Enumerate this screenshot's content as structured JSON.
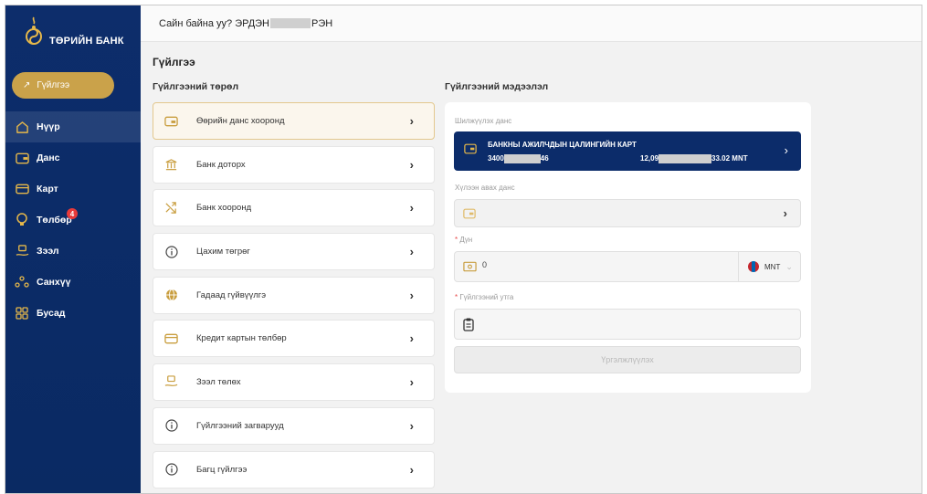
{
  "brand": {
    "name": "ТӨРИЙН БАНК",
    "accent": "#caa24a",
    "navy": "#0d2d6b"
  },
  "header": {
    "greeting_prefix": "Сайн байна уу? ЭРДЭН",
    "greeting_suffix": "РЭН"
  },
  "sidebar": {
    "transfer_button": "Гүйлгээ",
    "items": [
      {
        "label": "Нүүр",
        "icon": "home-icon"
      },
      {
        "label": "Данс",
        "icon": "wallet-icon"
      },
      {
        "label": "Карт",
        "icon": "card-icon"
      },
      {
        "label": "Төлбөр",
        "icon": "bulb-icon",
        "badge": "4"
      },
      {
        "label": "Зээл",
        "icon": "loan-hand-icon"
      },
      {
        "label": "Санхүү",
        "icon": "finance-people-icon"
      },
      {
        "label": "Бусад",
        "icon": "grid-icon"
      }
    ]
  },
  "main": {
    "title": "Гүйлгээ",
    "types_title": "Гүйлгээний төрөл",
    "info_title": "Гүйлгээний мэдээлэл",
    "types": [
      {
        "label": "Өөрийн данс хооронд",
        "icon": "card-icon"
      },
      {
        "label": "Банк доторх",
        "icon": "bank-icon"
      },
      {
        "label": "Банк хооронд",
        "icon": "transfer-arrows-icon"
      },
      {
        "label": "Цахим төгрөг",
        "icon": "info-icon"
      },
      {
        "label": "Гадаад гүйвүүлгэ",
        "icon": "globe-icon"
      },
      {
        "label": "Кредит картын төлбөр",
        "icon": "card-icon"
      },
      {
        "label": "Зээл төлөх",
        "icon": "loan-hand-icon"
      },
      {
        "label": "Гүйлгээний загварууд",
        "icon": "info-icon"
      },
      {
        "label": "Багц гүйлгээ",
        "icon": "info-icon"
      }
    ]
  },
  "form": {
    "source_label": "Шилжүүлэх данс",
    "card_title": "БАНКНЫ АЖИЛЧДЫН ЦАЛИНГИЙН КАРТ",
    "card_account_prefix": "3400",
    "card_account_suffix": "46",
    "card_balance_prefix": "12,09",
    "card_balance_suffix": "33.02 MNT",
    "dest_label": "Хүлээн авах данс",
    "amount_label": "Дүн",
    "amount_value": "0",
    "currency": "MNT",
    "purpose_label": "Гүйлгээний утга",
    "continue_label": "Үргэлжлүүлэх"
  }
}
